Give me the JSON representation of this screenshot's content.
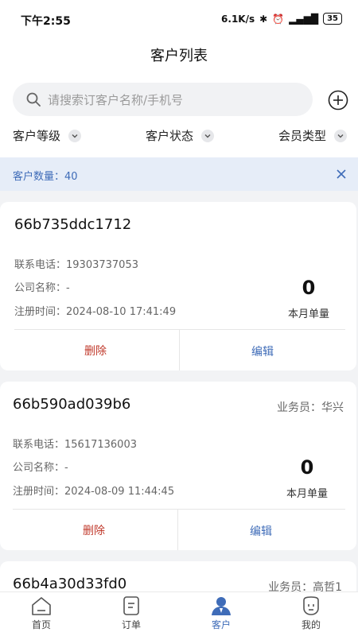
{
  "status_bar": {
    "time": "下午2:55",
    "speed": "6.1K/s",
    "battery": "35"
  },
  "header": {
    "title": "客户列表"
  },
  "search": {
    "placeholder": "请搜索订客户名称/手机号"
  },
  "filters": [
    {
      "label": "客户等级"
    },
    {
      "label": "客户状态"
    },
    {
      "label": "会员类型"
    }
  ],
  "count_bar": {
    "label": "客户数量：40"
  },
  "customers": [
    {
      "id": "66b735ddc1712",
      "salesperson": "",
      "phone_label": "联系电话：",
      "phone": "19303737053",
      "company_label": "公司名称：",
      "company": "-",
      "registered_label": "注册时间：",
      "registered": "2024-08-10 17:41:49",
      "monthly_orders": "0",
      "monthly_orders_label": "本月单量",
      "delete_label": "删除",
      "edit_label": "编辑"
    },
    {
      "id": "66b590ad039b6",
      "salesperson": "业务员：华兴",
      "phone_label": "联系电话：",
      "phone": "15617136003",
      "company_label": "公司名称：",
      "company": "-",
      "registered_label": "注册时间：",
      "registered": "2024-08-09 11:44:45",
      "monthly_orders": "0",
      "monthly_orders_label": "本月单量",
      "delete_label": "删除",
      "edit_label": "编辑"
    },
    {
      "id": "66b4a30d33fd0",
      "salesperson": "业务员：高哲1"
    }
  ],
  "tabbar": [
    {
      "label": "首页",
      "icon": "home-icon"
    },
    {
      "label": "订单",
      "icon": "order-icon"
    },
    {
      "label": "客户",
      "icon": "customer-icon",
      "active": true
    },
    {
      "label": "我的",
      "icon": "profile-icon"
    }
  ],
  "colors": {
    "accent": "#3f6cb8",
    "delete": "#c0392b",
    "count_bg": "#e6edf8"
  }
}
